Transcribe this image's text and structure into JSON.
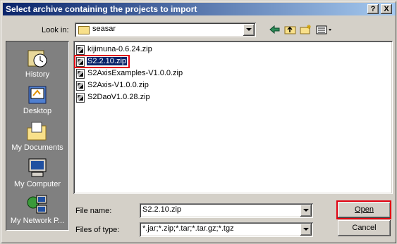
{
  "window": {
    "title": "Select archive containing the projects to import"
  },
  "titlebar": {
    "help_label": "?",
    "close_label": "X"
  },
  "lookin": {
    "label": "Look in:",
    "value": "seasar"
  },
  "places": [
    {
      "label": "History",
      "icon": "history-icon"
    },
    {
      "label": "Desktop",
      "icon": "desktop-icon"
    },
    {
      "label": "My Documents",
      "icon": "my-documents-icon"
    },
    {
      "label": "My Computer",
      "icon": "my-computer-icon"
    },
    {
      "label": "My Network P...",
      "icon": "my-network-places-icon"
    }
  ],
  "files": [
    {
      "name": "kijimuna-0.6.24.zip",
      "selected": false
    },
    {
      "name": "S2.2.10.zip",
      "selected": true
    },
    {
      "name": "S2AxisExamples-V1.0.0.zip",
      "selected": false
    },
    {
      "name": "S2Axis-V1.0.0.zip",
      "selected": false
    },
    {
      "name": "S2DaoV1.0.28.zip",
      "selected": false
    }
  ],
  "filename": {
    "label": "File name:",
    "value": "S2.2.10.zip"
  },
  "filetype": {
    "label": "Files of type:",
    "value": "*.jar;*.zip;*.tar;*.tar.gz;*.tgz"
  },
  "buttons": {
    "open": "Open",
    "cancel": "Cancel"
  },
  "colors": {
    "titlebar_start": "#0a246a",
    "titlebar_end": "#a6caf0",
    "highlight_box": "#e00010",
    "selection": "#0a246a"
  }
}
